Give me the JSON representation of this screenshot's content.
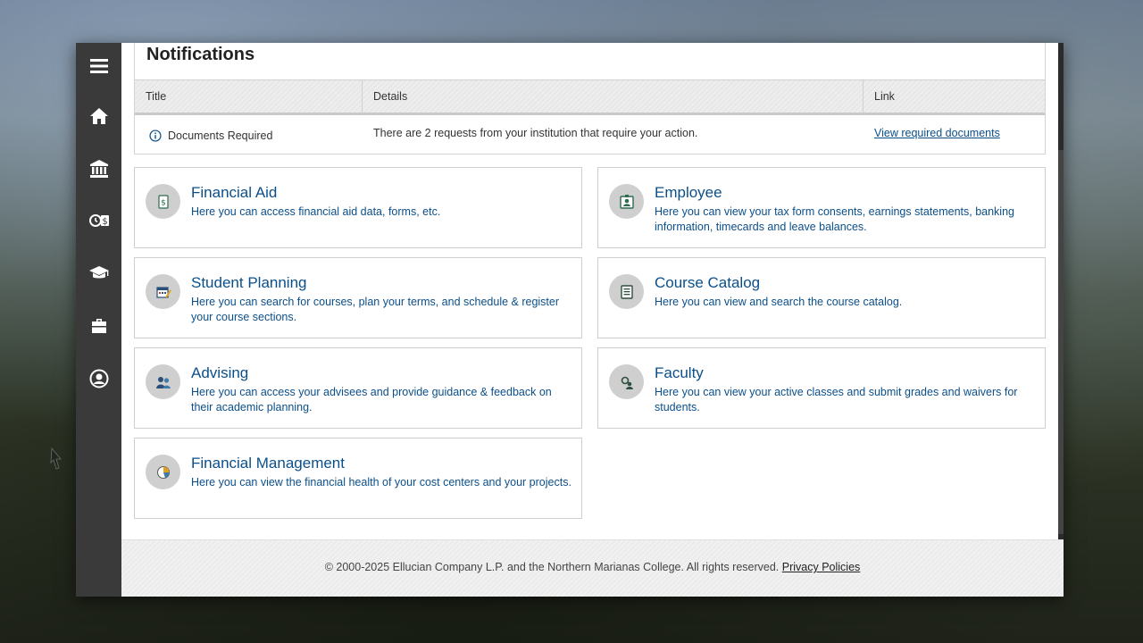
{
  "notifications": {
    "title": "Notifications",
    "columns": {
      "title": "Title",
      "details": "Details",
      "link": "Link"
    },
    "rows": [
      {
        "title": "Documents Required",
        "details": "There are 2 requests from your institution that require your action.",
        "link": "View required documents"
      }
    ]
  },
  "sidebar": {
    "items": [
      {
        "name": "menu-icon"
      },
      {
        "name": "home-icon"
      },
      {
        "name": "bank-icon"
      },
      {
        "name": "money-icon"
      },
      {
        "name": "graduation-cap-icon"
      },
      {
        "name": "briefcase-icon"
      },
      {
        "name": "user-circle-icon"
      }
    ]
  },
  "cards": [
    {
      "title": "Financial Aid",
      "desc": "Here you can access financial aid data, forms, etc.",
      "icon": "financial-aid-icon"
    },
    {
      "title": "Employee",
      "desc": "Here you can view your tax form consents, earnings statements, banking information, timecards and leave balances.",
      "icon": "employee-icon"
    },
    {
      "title": "Student Planning",
      "desc": "Here you can search for courses, plan your terms, and schedule & register your course sections.",
      "icon": "student-planning-icon"
    },
    {
      "title": "Course Catalog",
      "desc": "Here you can view and search the course catalog.",
      "icon": "course-catalog-icon"
    },
    {
      "title": "Advising",
      "desc": "Here you can access your advisees and provide guidance & feedback on their academic planning.",
      "icon": "advising-icon"
    },
    {
      "title": "Faculty",
      "desc": "Here you can view your active classes and submit grades and waivers for students.",
      "icon": "faculty-icon"
    },
    {
      "title": "Financial Management",
      "desc": "Here you can view the financial health of your cost centers and your projects.",
      "icon": "financial-management-icon"
    }
  ],
  "footer": {
    "copyright": "© 2000-2025 Ellucian Company L.P. and the Northern Marianas College. All rights reserved.",
    "privacy": "Privacy Policies"
  },
  "colors": {
    "accent": "#0b4f8a",
    "sidebar": "#3a3a3a"
  }
}
